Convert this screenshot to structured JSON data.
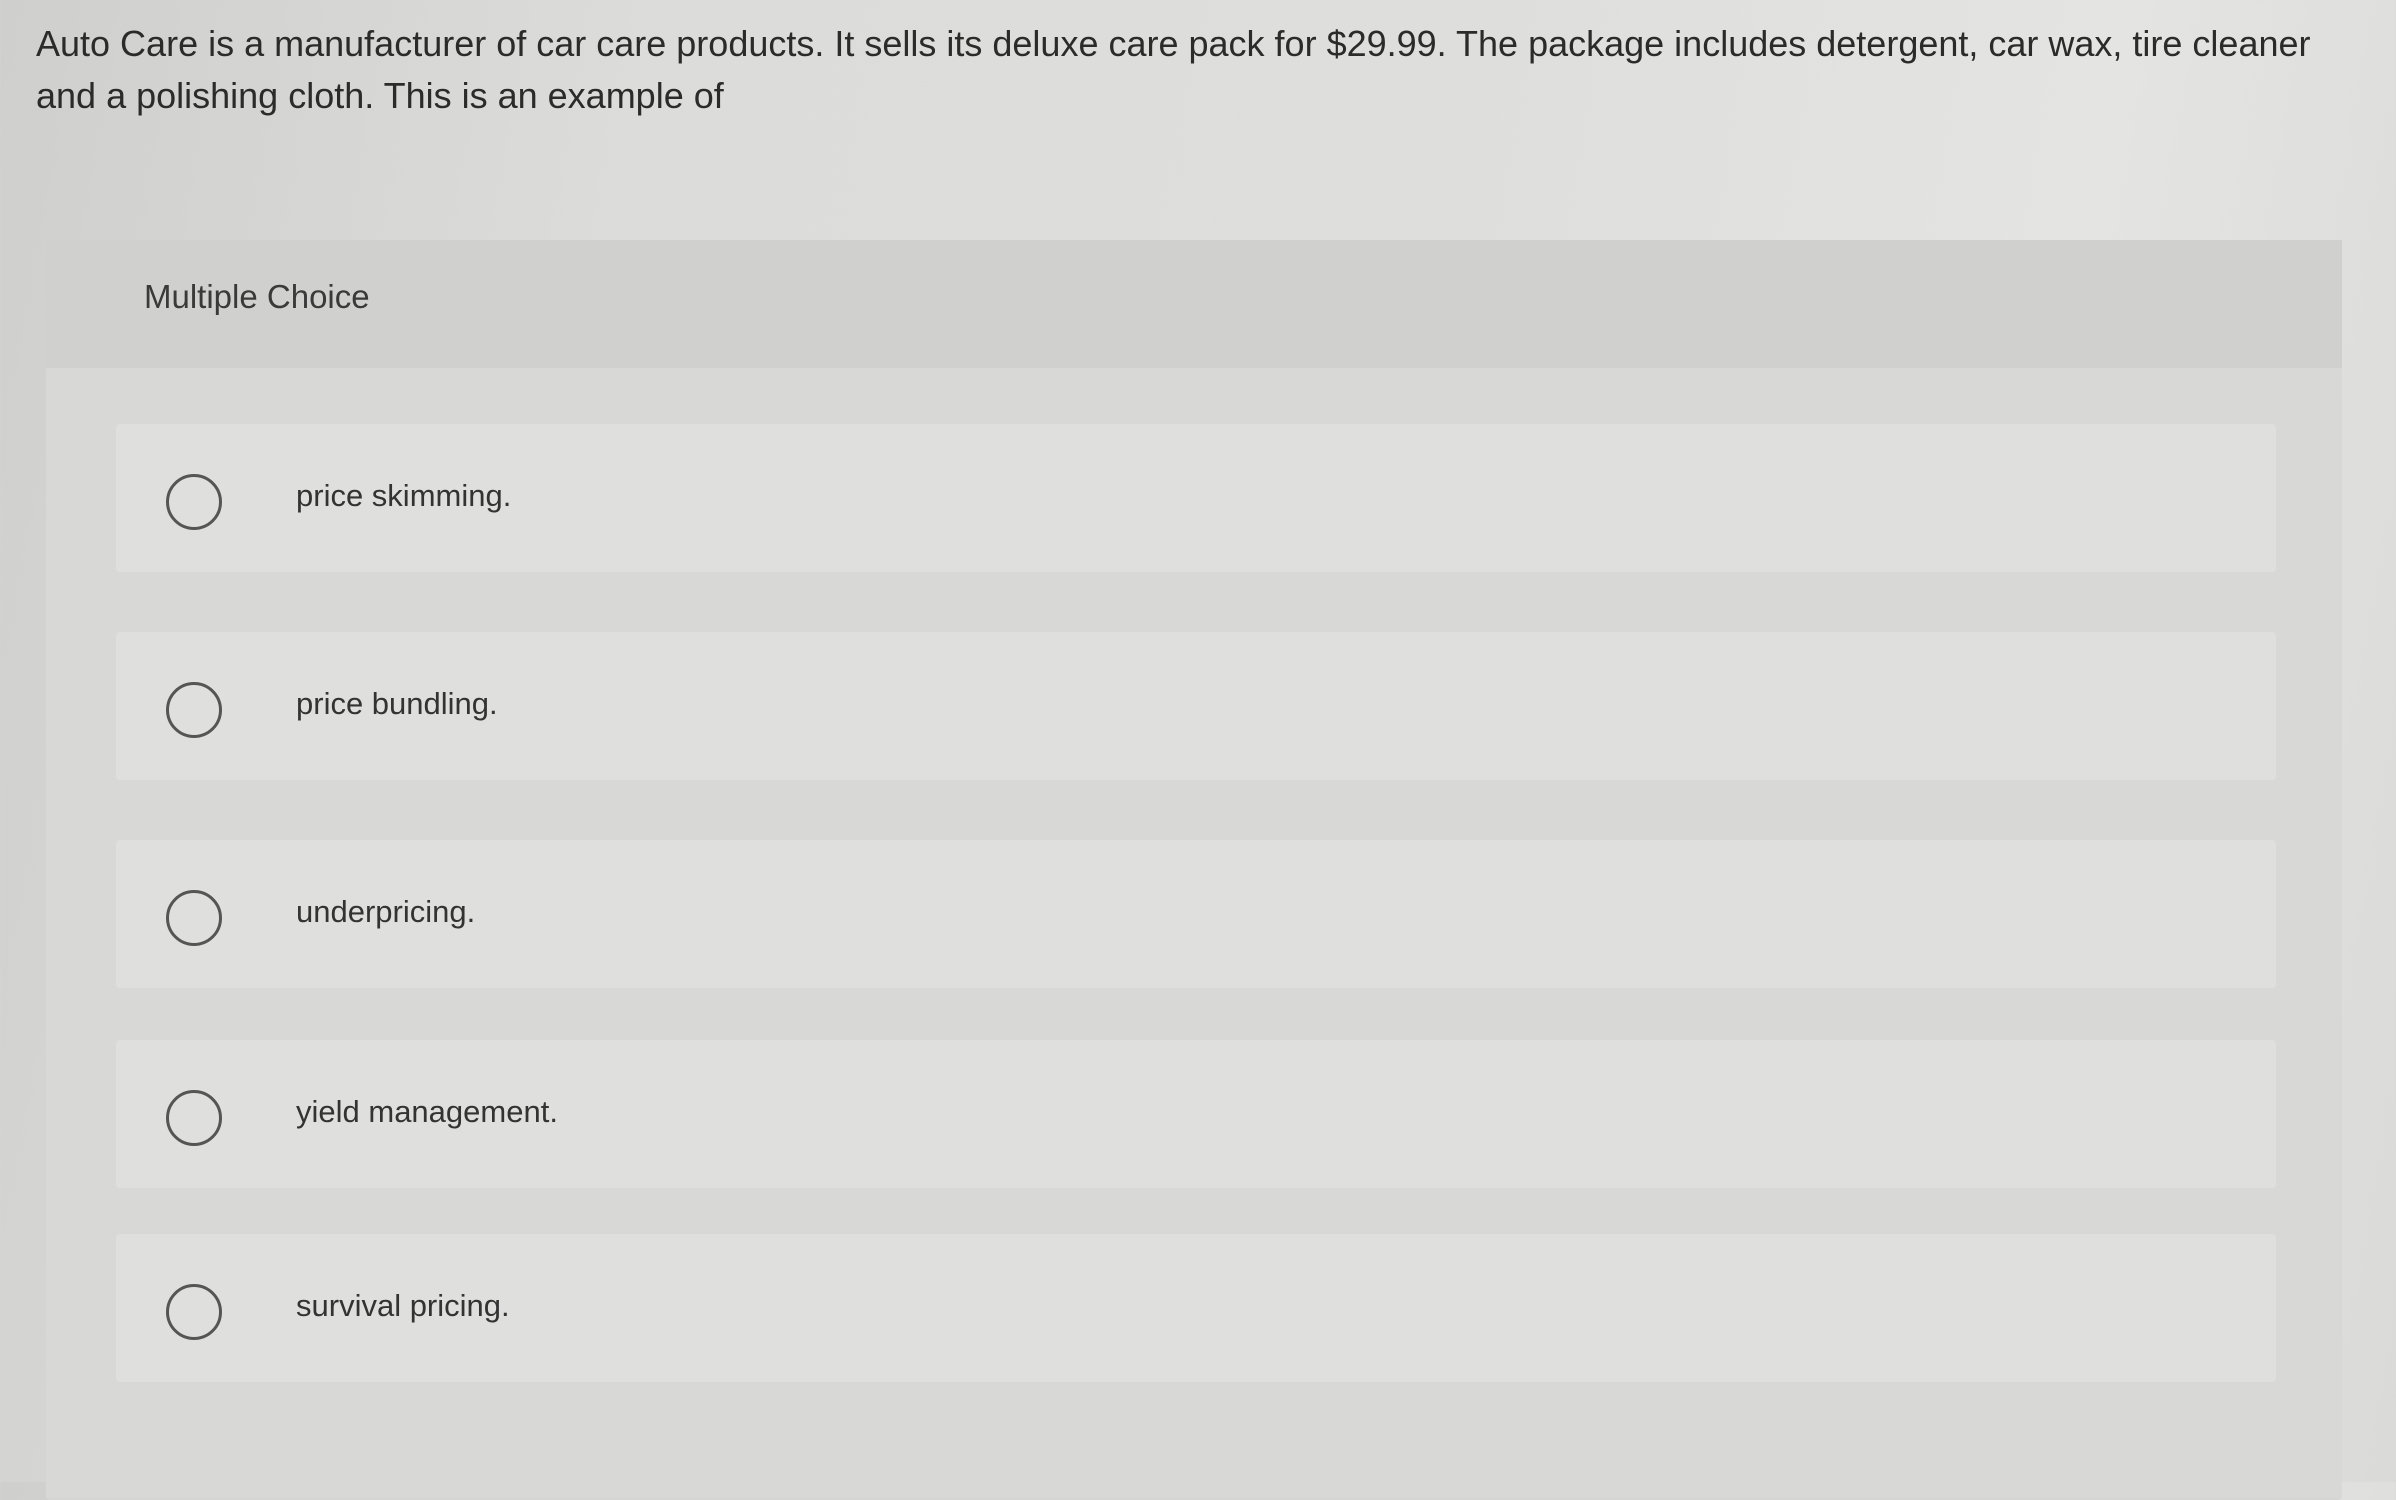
{
  "question": {
    "text": "Auto Care is a manufacturer of car care products. It sells its deluxe care pack for $29.99. The package includes detergent, car wax, tire cleaner and a polishing cloth. This is an example of"
  },
  "panel": {
    "header_label": "Multiple Choice"
  },
  "options": [
    {
      "label": "price skimming.",
      "selected": false
    },
    {
      "label": "price bundling.",
      "selected": false
    },
    {
      "label": "underpricing.",
      "selected": false
    },
    {
      "label": "yield management.",
      "selected": false
    },
    {
      "label": "survival pricing.",
      "selected": false
    }
  ],
  "colors": {
    "background": "#dcdcda",
    "panel": "#d5d5d3",
    "option_row": "#dfdfdd",
    "radio_border": "#555555",
    "text": "#2b2b2b"
  }
}
